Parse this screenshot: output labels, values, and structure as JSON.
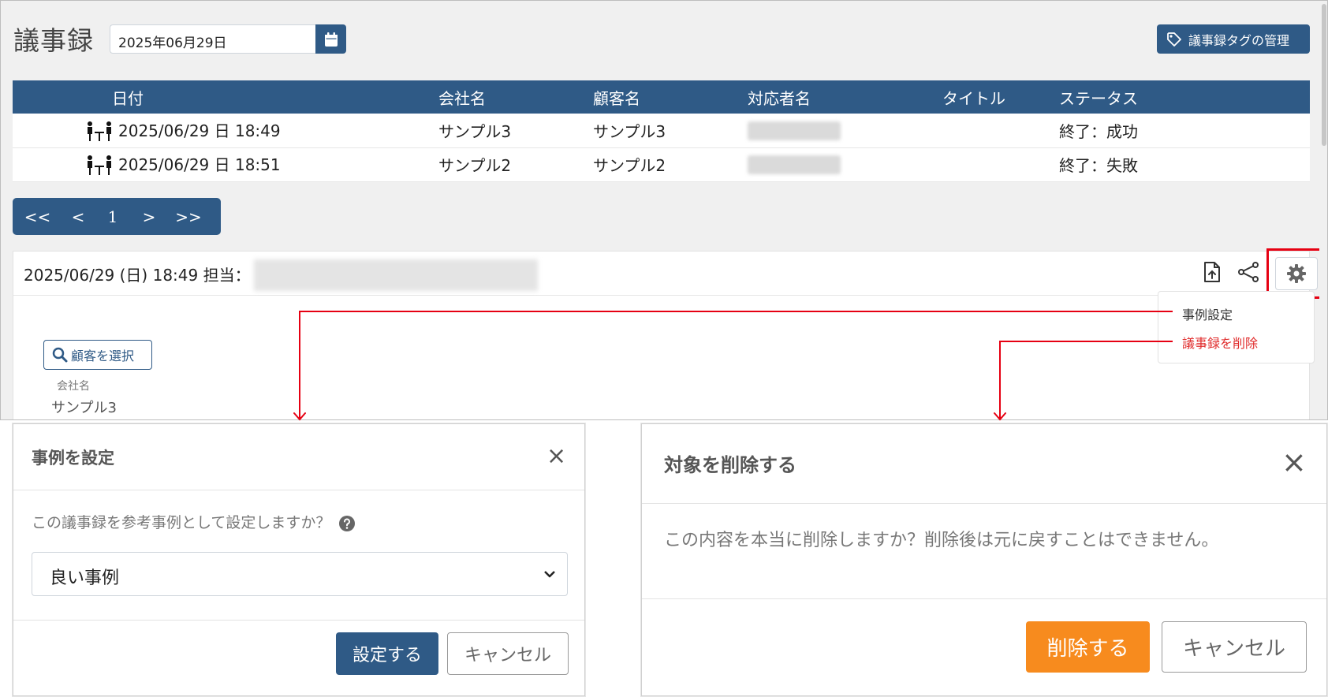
{
  "app": {
    "page_title": "議事録",
    "date_value": "2025年06月29日",
    "tag_button_label": "議事録タグの管理"
  },
  "table": {
    "headers": [
      "日付",
      "会社名",
      "顧客名",
      "対応者名",
      "タイトル",
      "ステータス"
    ],
    "rows": [
      {
        "date": "2025/06/29 日 18:49",
        "company": "サンプル3",
        "customer": "サンプル3",
        "status": "終了：成功"
      },
      {
        "date": "2025/06/29 日 18:51",
        "company": "サンプル2",
        "customer": "サンプル2",
        "status": "終了：失敗"
      }
    ]
  },
  "pager": {
    "first": "<<",
    "prev": "<",
    "page": "1",
    "next": ">",
    "last": ">>"
  },
  "detail": {
    "header_text": "2025/06/29 (日) 18:49 担当：",
    "select_customer_label": "顧客を選択",
    "company_label": "会社名",
    "company_value": "サンプル3"
  },
  "menu": {
    "case_setting": "事例設定",
    "delete_minutes": "議事録を削除"
  },
  "dialog_case": {
    "title": "事例を設定",
    "question": "この議事録を参考事例として設定しますか？",
    "selected_option": "良い事例",
    "confirm_label": "設定する",
    "cancel_label": "キャンセル"
  },
  "dialog_delete": {
    "title": "対象を削除する",
    "message": "この内容を本当に削除しますか？削除後は元に戻すことはできません。",
    "confirm_label": "削除する",
    "cancel_label": "キャンセル"
  },
  "colors": {
    "primary": "#2f5a86",
    "highlight": "#e60012",
    "danger_text": "#e02b2b",
    "delete_button": "#f78b1e"
  },
  "icons": [
    "calendar-icon",
    "tag-icon",
    "meeting-icon",
    "upload-icon",
    "share-icon",
    "gear-icon",
    "search-icon",
    "close-icon",
    "help-icon",
    "chevron-down-icon"
  ]
}
